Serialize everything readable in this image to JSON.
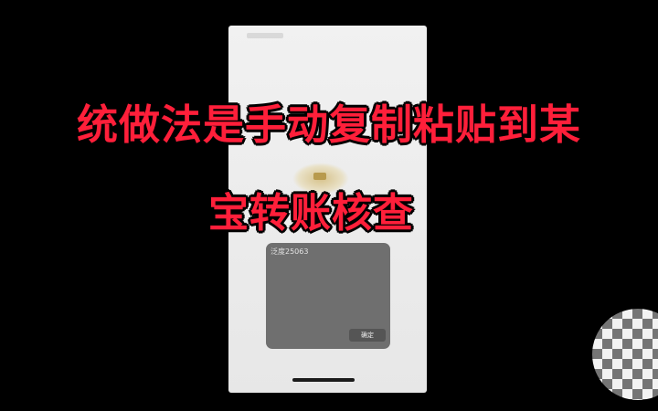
{
  "overlay": {
    "line1": "统做法是手动复制粘贴到某",
    "line2": "宝转账核查"
  },
  "dialog": {
    "message": "泛度25063",
    "confirm_label": "确定"
  },
  "colors": {
    "overlay_text": "#ff1f3a",
    "background": "#000000",
    "dialog": "#6f6f6f"
  }
}
